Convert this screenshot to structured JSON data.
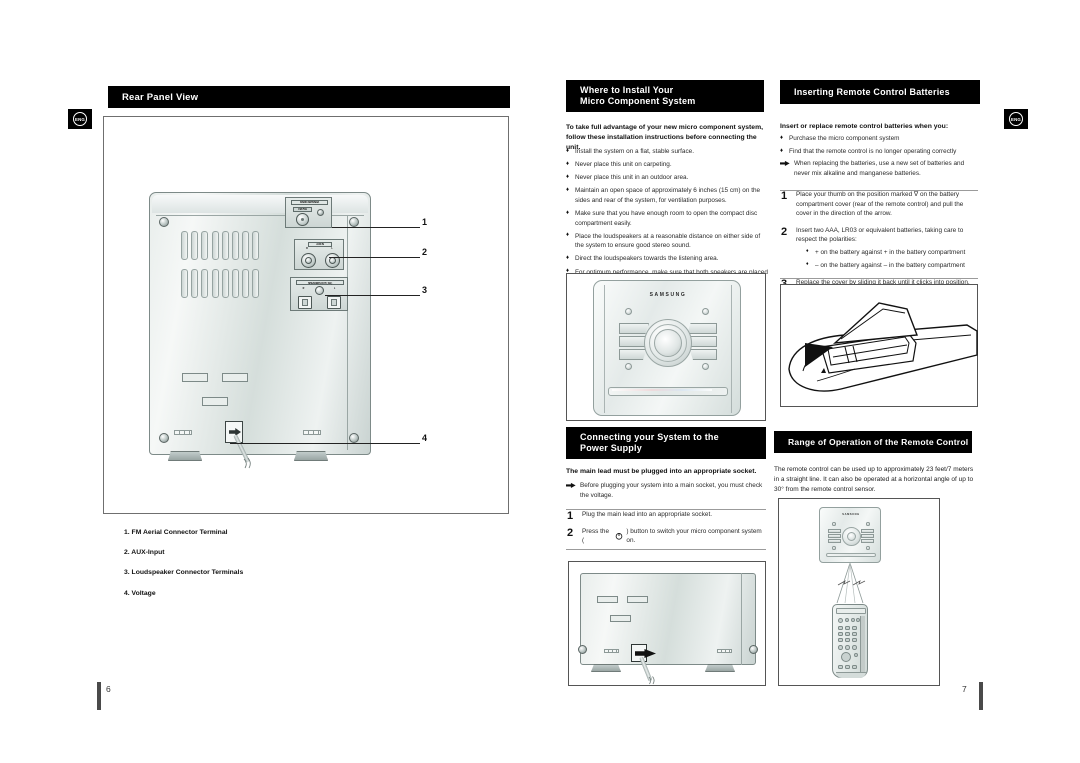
{
  "document": {
    "language_tab": "ENG",
    "left_page_number": "6",
    "right_page_number": "7"
  },
  "sections": {
    "rear_panel": {
      "title": "Rear Panel View",
      "legend": [
        "1.  FM Aerial Connector Terminal",
        "2.  AUX-Input",
        "3.  Loudspeaker Connector Terminals",
        "4.  Voltage"
      ],
      "callouts": [
        "1",
        "2",
        "3",
        "4"
      ],
      "panel_labels": {
        "fm_aerial": "RADIO ANTENNA",
        "fm_aerial_sub": "FM  75Ω",
        "aux_in": "AUX IN",
        "aux_left": "L",
        "aux_right": "R",
        "speakers_out": "SPEAKERS  OUT ( 4Ω )",
        "speaker_right": "R",
        "speaker_left": "L"
      }
    },
    "install": {
      "title_line1": "Where to Install Your",
      "title_line2": "Micro Component System",
      "intro_line1": "To take full advantage of your new micro component system,",
      "intro_line2": "follow these installation instructions before connecting the unit.",
      "bullets": [
        "Install the system on a flat, stable surface.",
        "Never place this unit on carpeting.",
        "Never place this unit in an outdoor area.",
        "Maintain an open space of approximately 6 inches (15 cm) on the sides and rear of the system, for ventilation purposes.",
        "Make sure that you have enough room to open the compact disc compartment easily.",
        "Place the loudspeakers at a reasonable distance on either side of the system to ensure good stereo sound.",
        "Direct the loudspeakers towards the listening area.",
        "For optimum performance, make sure that both speakers are placed at an equal distance above the floor."
      ],
      "device_brand": "SAMSUNG"
    },
    "batteries": {
      "title": "Inserting Remote Control Batteries",
      "intro": "Insert or replace remote control batteries when you:",
      "bullets": [
        "Purchase the micro component system",
        "Find that the remote control is no longer operating correctly"
      ],
      "note": "When replacing the batteries, use a new set of batteries and never mix alkaline and manganese batteries.",
      "steps": [
        {
          "num": "1",
          "text": "Place your thumb on the position marked ∇ on the battery compartment cover (rear of the remote control) and pull the cover in the direction of the arrow."
        },
        {
          "num": "2",
          "text": "Insert two AAA, LR03 or equivalent batteries, taking care to respect the polarities:",
          "sub": [
            "+ on the battery against + in the battery compartment",
            "– on the battery against – in the battery compartment"
          ]
        },
        {
          "num": "3",
          "text": "Replace the cover by sliding it back until it clicks into position."
        }
      ]
    },
    "power": {
      "title_line1": "Connecting your System to the",
      "title_line2": "Power Supply",
      "lead": "The main lead must be plugged into an appropriate socket.",
      "note": "Before plugging your system into a main socket, you must check the voltage.",
      "steps": [
        {
          "num": "1",
          "text": "Plug the main lead into an appropriate socket."
        },
        {
          "num": "2",
          "text_before": "Press the (",
          "power_symbol": "⏻",
          "text_after": ") button to switch your micro component system on."
        }
      ]
    },
    "range": {
      "title": "Range of Operation of the Remote Control",
      "body": "The remote control can be used up to approximately 23 feet/7 meters in a straight line. It can also be operated at a horizontal angle of up to 30° from the remote control sensor.",
      "device_brand": "SAMSUNG"
    }
  },
  "colors": {
    "header_bar": "#000000",
    "header_text": "#ffffff",
    "body_text": "#2a2a2a",
    "rule": "#9b9b9b"
  }
}
